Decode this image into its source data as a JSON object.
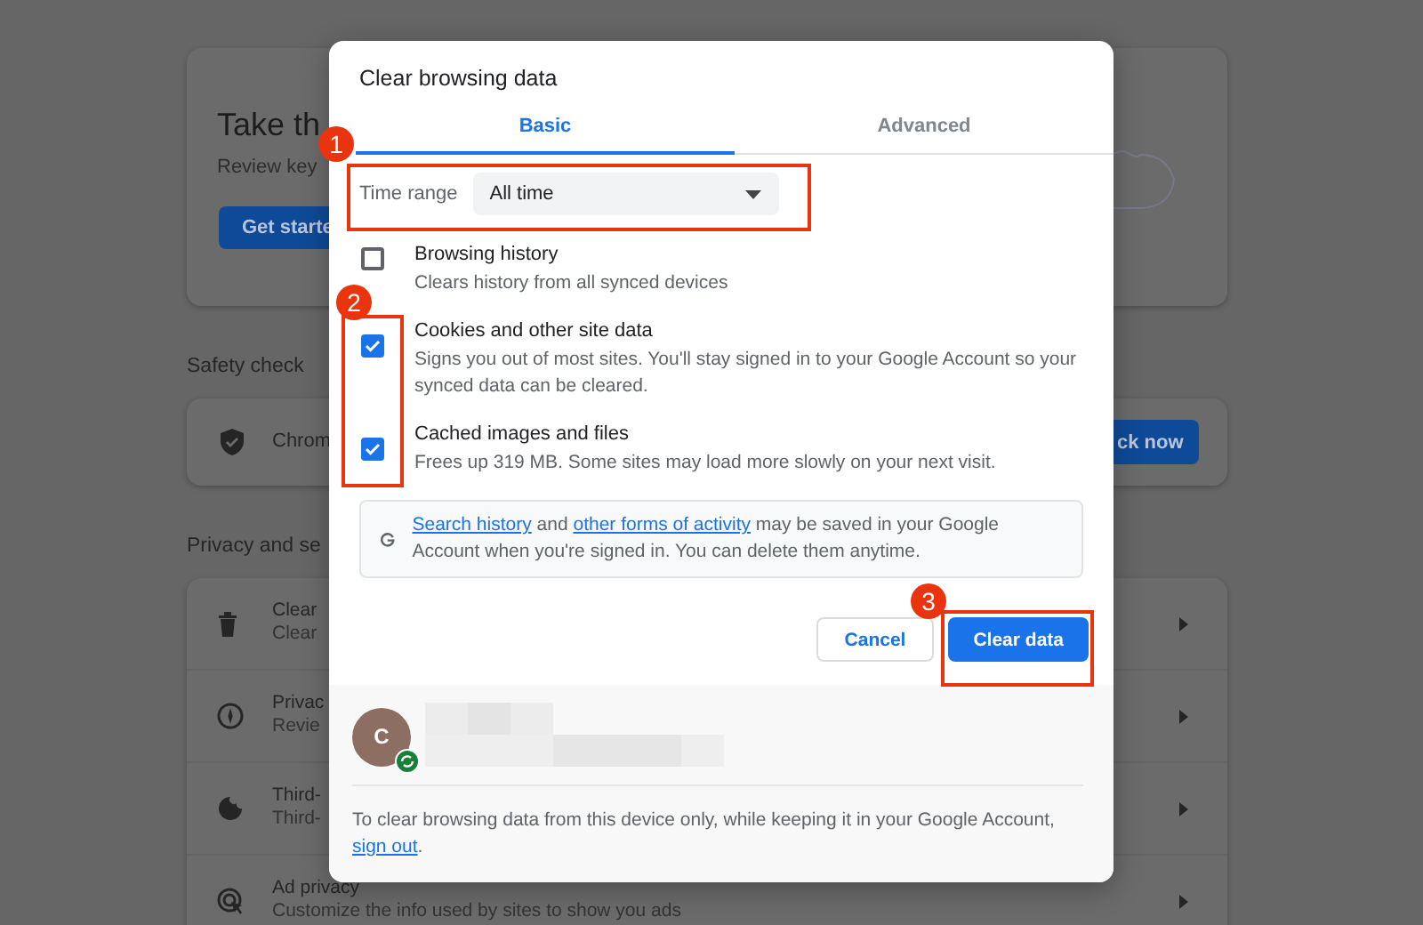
{
  "background": {
    "hero_card": {
      "title": "Take th",
      "subtitle": "Review key",
      "button": "Get starte"
    },
    "safety_heading": "Safety check",
    "safety_card": {
      "label": "Chrom",
      "button": "ck now"
    },
    "privacy_heading": "Privacy and se",
    "privacy_rows": [
      {
        "kind": "trash",
        "title": "Clear",
        "subtitle": "Clear"
      },
      {
        "kind": "compass",
        "title": "Privac",
        "subtitle": "Revie"
      },
      {
        "kind": "cookie",
        "title": "Third-",
        "subtitle": "Third-"
      },
      {
        "kind": "target",
        "title": "Ad privacy",
        "subtitle": "Customize the info used by sites to show you ads"
      }
    ]
  },
  "dialog": {
    "title": "Clear browsing data",
    "tabs": [
      {
        "label": "Basic",
        "selected": true
      },
      {
        "label": "Advanced",
        "selected": false
      }
    ],
    "time_range": {
      "label": "Time range",
      "value": "All time"
    },
    "options": [
      {
        "title": "Browsing history",
        "description": "Clears history from all synced devices",
        "checked": false
      },
      {
        "title": "Cookies and other site data",
        "description": "Signs you out of most sites. You'll stay signed in to your Google Account so your synced data can be cleared.",
        "checked": true
      },
      {
        "title": "Cached images and files",
        "description": "Frees up 319 MB. Some sites may load more slowly on your next visit.",
        "checked": true
      }
    ],
    "info": [
      {
        "text": "Search history",
        "link": true
      },
      {
        "text": " and ",
        "link": false
      },
      {
        "text": "other forms of activity",
        "link": true
      },
      {
        "text": " may be saved in your Google Account when you're signed in. You can delete them anytime.",
        "link": false
      }
    ],
    "buttons": [
      {
        "label": "Cancel",
        "kind": "secondary"
      },
      {
        "label": "Clear data",
        "kind": "primary"
      }
    ],
    "account": {
      "avatar_letter": "C"
    },
    "footer": [
      {
        "text": "To clear browsing data from this device only, while keeping it in your Google Account, ",
        "link": false
      },
      {
        "text": "sign out",
        "link": true
      },
      {
        "text": ".",
        "link": false
      }
    ]
  },
  "annotations": [
    {
      "number": "1"
    },
    {
      "number": "2"
    },
    {
      "number": "3"
    }
  ]
}
